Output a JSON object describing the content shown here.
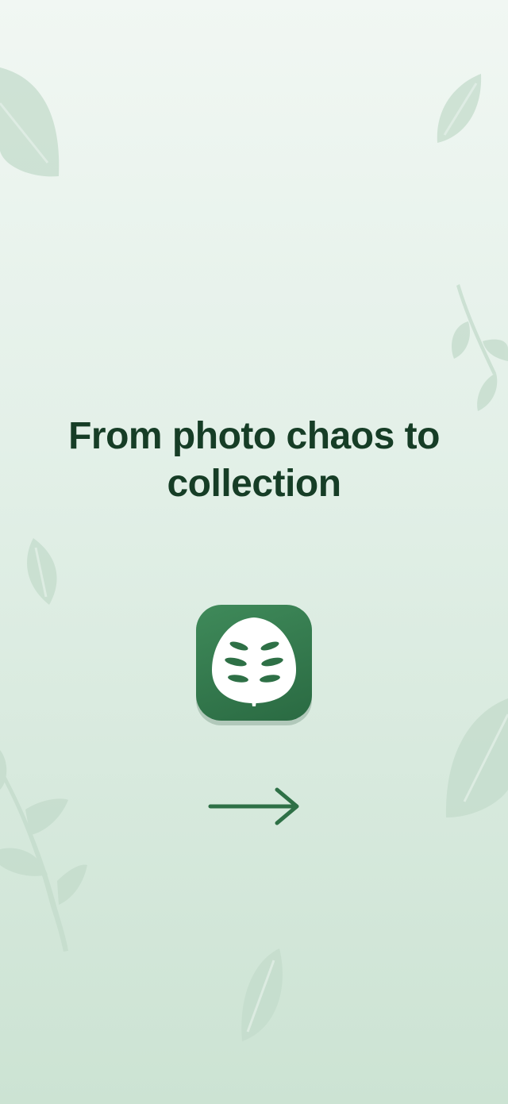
{
  "onboarding": {
    "headline": "From photo chaos to collection"
  },
  "icons": {
    "app_logo": "leaf-app-icon",
    "next": "arrow-right-icon",
    "background": "decorative-leaves"
  },
  "colors": {
    "headline": "#163d26",
    "brand_green": "#2e7046",
    "arrow": "#2e7046",
    "background_top": "#f1f7f3",
    "background_bottom": "#cce3d3",
    "leaf_decor": "#c5dccd"
  }
}
